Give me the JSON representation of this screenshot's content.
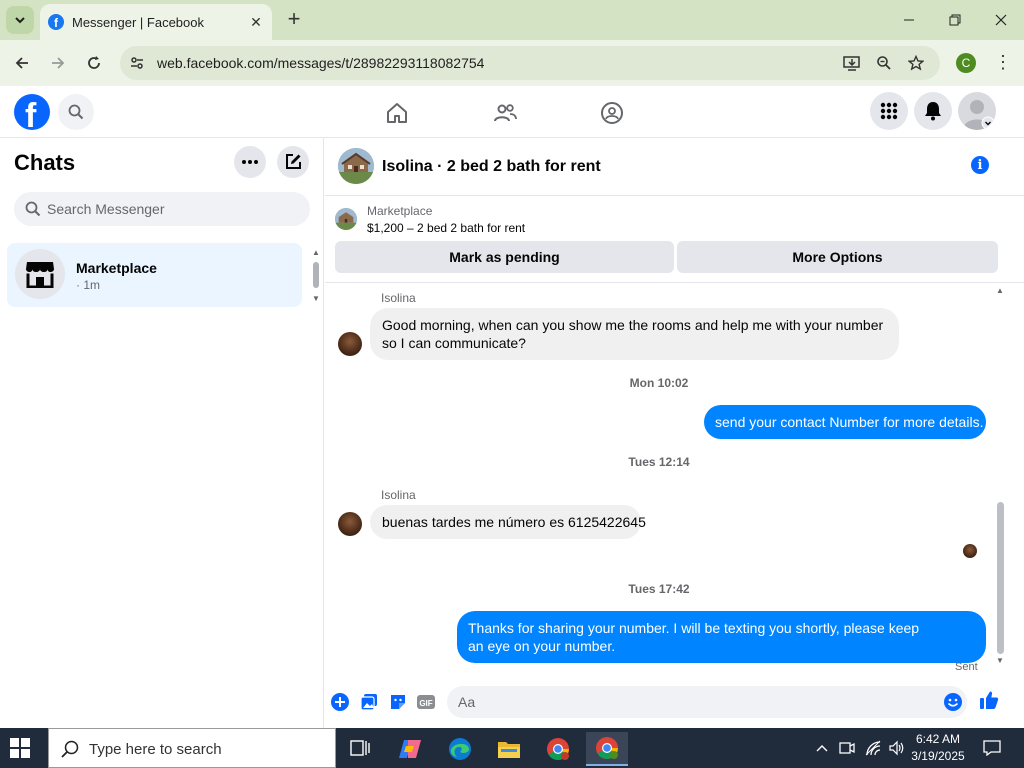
{
  "browser": {
    "tab_title": "Messenger | Facebook",
    "tab_close": "✕",
    "new_tab": "+",
    "url": "web.facebook.com/messages/t/28982293118082754",
    "profile_initial": "C"
  },
  "facebook": {
    "logo": "f"
  },
  "sidebar": {
    "title": "Chats",
    "search_placeholder": "Search Messenger",
    "chats": [
      {
        "name": "Marketplace",
        "time": "· 1m"
      }
    ]
  },
  "conversation": {
    "title": "Isolina · 2 bed 2 bath for rent",
    "marketplace_label": "Marketplace",
    "listing": "$1,200 – 2 bed 2 bath for rent",
    "mark_pending_label": "Mark as pending",
    "more_options_label": "More Options",
    "messages": [
      {
        "sender": "Isolina",
        "text": "Good morning, when can you show me the rooms and help me with your number so I can communicate?"
      },
      {
        "timestamp": "Mon 10:02"
      },
      {
        "text": "send your contact Number for more details."
      },
      {
        "timestamp": "Tues 12:14"
      },
      {
        "sender": "Isolina",
        "text": "buenas tardes me número es 6125422645"
      },
      {
        "timestamp": "Tues 17:42"
      },
      {
        "text": "Thanks for sharing your number. I will be texting you shortly, please keep an eye on your number."
      }
    ],
    "sent_status": "Sent",
    "composer_placeholder": "Aa",
    "gif_label": "GIF"
  },
  "taskbar": {
    "search_text": "Type here to search",
    "time": "6:42 AM",
    "date": "3/19/2025"
  },
  "colors": {
    "facebook_blue": "#0866ff",
    "outgoing_bubble": "#0084ff",
    "incoming_bubble": "#f0f0f0",
    "selected_chat": "#ebf5ff",
    "browser_frame": "#d3e3c3"
  },
  "icons": {
    "browser": [
      "chevron-down-icon",
      "facebook-favicon",
      "close-icon",
      "plus-icon",
      "minimize-icon",
      "restore-icon",
      "back-icon",
      "forward-icon",
      "reload-icon",
      "site-info-icon",
      "install-icon",
      "zoom-icon",
      "star-icon",
      "menu-icon"
    ],
    "facebook": [
      "search-icon",
      "home-icon",
      "friends-icon",
      "groups-icon",
      "menu-grid-icon",
      "bell-icon",
      "profile-icon"
    ],
    "messenger": [
      "more-icon",
      "compose-icon",
      "store-icon",
      "info-icon",
      "plus-circle-icon",
      "photo-icon",
      "sticker-icon",
      "gif-icon",
      "emoji-icon",
      "like-icon"
    ],
    "taskbar": [
      "windows-start-icon",
      "search-icon",
      "task-view-icon",
      "copilot-icon",
      "edge-icon",
      "file-explorer-icon",
      "chrome-icon",
      "chrome-profile-icon",
      "chevron-up-icon",
      "meet-icon",
      "network-icon",
      "volume-icon",
      "notifications-icon"
    ]
  }
}
